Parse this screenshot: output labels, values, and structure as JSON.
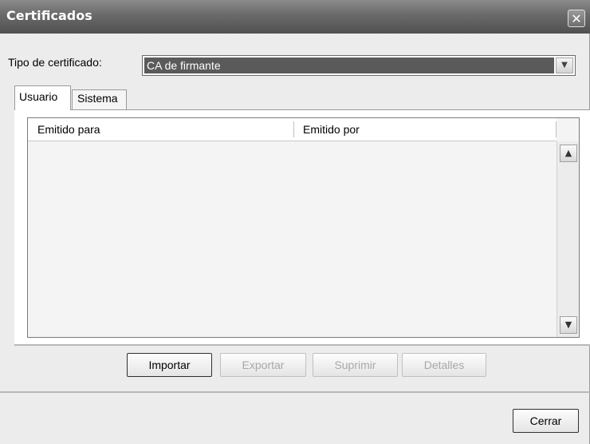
{
  "window": {
    "title": "Certificados"
  },
  "certificate_type": {
    "label": "Tipo de certificado:",
    "selected": "CA de firmante"
  },
  "tabs": [
    {
      "label": "Usuario",
      "active": true
    },
    {
      "label": "Sistema",
      "active": false
    }
  ],
  "table": {
    "columns": [
      "Emitido para",
      "Emitido por"
    ],
    "rows": []
  },
  "buttons": {
    "importar": {
      "label": "Importar",
      "enabled": true
    },
    "exportar": {
      "label": "Exportar",
      "enabled": false
    },
    "suprimir": {
      "label": "Suprimir",
      "enabled": false
    },
    "detalles": {
      "label": "Detalles",
      "enabled": false
    },
    "cerrar": {
      "label": "Cerrar",
      "enabled": true
    }
  },
  "icons": {
    "close": "close-icon",
    "dropdown": "chevron-down-icon",
    "scroll_up": "chevron-up-icon",
    "scroll_down": "chevron-down-icon"
  }
}
